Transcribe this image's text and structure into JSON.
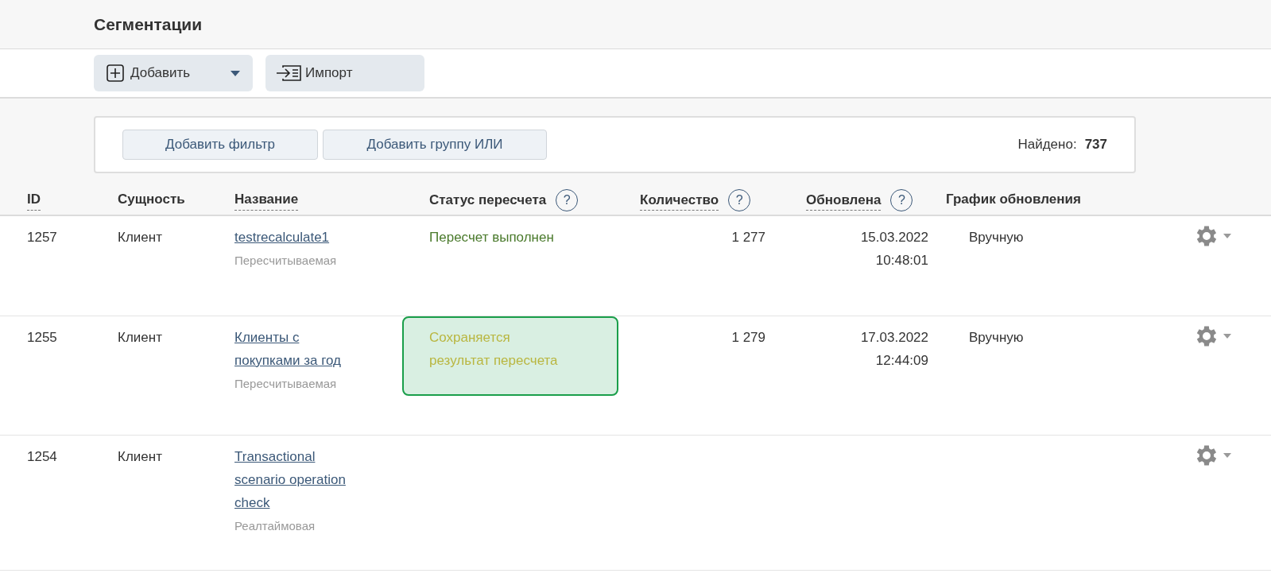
{
  "page_title": "Сегментации",
  "toolbar": {
    "add_button": "Добавить",
    "import_button": "Импорт"
  },
  "filters": {
    "add_filter_button": "Добавить фильтр",
    "add_or_group_button": "Добавить группу ИЛИ",
    "found_label": "Найдено:",
    "found_count": "737"
  },
  "table": {
    "columns": [
      {
        "label": "ID",
        "sortable": true
      },
      {
        "label": "Сущность",
        "sortable": false
      },
      {
        "label": "Название",
        "sortable": true
      },
      {
        "label": "Статус пересчета",
        "sortable": false,
        "help": "?"
      },
      {
        "label": "Количество",
        "sortable": true,
        "help": "?"
      },
      {
        "label": "Обновлена",
        "sortable": true,
        "help": "?"
      },
      {
        "label": "График обновления",
        "sortable": false
      }
    ],
    "rows": [
      {
        "id": "1257",
        "entity": "Клиент",
        "name": "testrecalculate1",
        "type": "Пересчитываемая",
        "status": {
          "kind": "done",
          "text": "Пересчет выполнен"
        },
        "count": "1 277",
        "updated_date": "15.03.2022",
        "updated_time": "10:48:01",
        "schedule": "Вручную"
      },
      {
        "id": "1255",
        "entity": "Клиент",
        "name": "Клиенты с покупками за год",
        "type": "Пересчитываемая",
        "status": {
          "kind": "saving",
          "text": "Сохраняется результат пересчета"
        },
        "count": "1 279",
        "updated_date": "17.03.2022",
        "updated_time": "12:44:09",
        "schedule": "Вручную"
      },
      {
        "id": "1254",
        "entity": "Клиент",
        "name": "Transactional scenario operation check",
        "type": "Реалтаймовая"
      }
    ]
  }
}
